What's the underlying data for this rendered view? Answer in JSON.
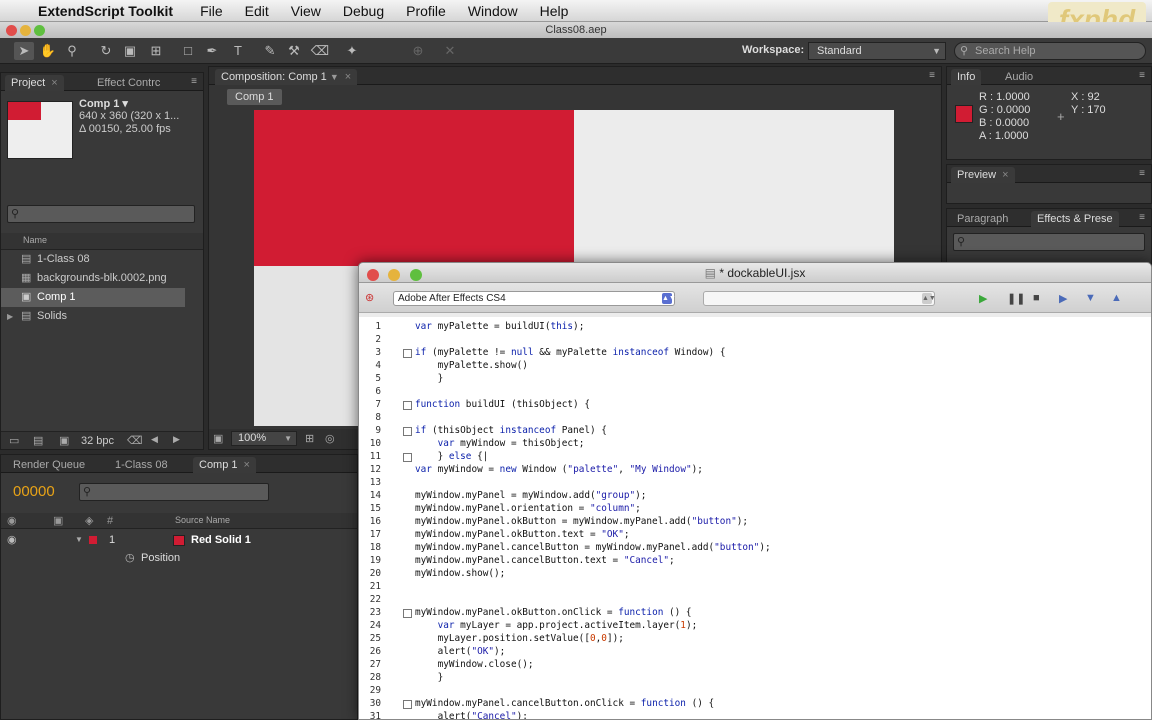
{
  "menubar": {
    "app": "ExtendScript Toolkit",
    "items": [
      "File",
      "Edit",
      "View",
      "Debug",
      "Profile",
      "Window",
      "Help"
    ],
    "logo": "fxphd"
  },
  "ae": {
    "title": "Class08.aep",
    "workspace_label": "Workspace:",
    "workspace_value": "Standard",
    "search_help": "Search Help"
  },
  "project": {
    "tab": "Project",
    "tab2": "Effect Contrc",
    "comp_name": "Comp 1 ▾",
    "comp_size": "640 x 360  (320 x 1...",
    "comp_duration": "Δ 00150, 25.00 fps",
    "col_name": "Name",
    "items": [
      "1-Class 08",
      "backgrounds-blk.0002.png",
      "Comp 1",
      "Solids"
    ],
    "bpc": "32 bpc"
  },
  "composition": {
    "tab": "Composition: Comp 1",
    "breadcrumb": "Comp 1",
    "zoom": "100%"
  },
  "info": {
    "tab": "Info",
    "tab2": "Audio",
    "r": "R : 1.0000",
    "g": "G : 0.0000",
    "b": "B : 0.0000",
    "a": "A : 1.0000",
    "x": "X : 92",
    "y": "Y : 170"
  },
  "preview": {
    "tab": "Preview"
  },
  "effects": {
    "tab1": "Paragraph",
    "tab2": "Effects & Prese"
  },
  "timeline": {
    "tabs": [
      "Render Queue",
      "1-Class 08",
      "Comp 1"
    ],
    "timecode": "00000",
    "col_source": "Source Name",
    "layer_num": "1",
    "layer_name": "Red Solid 1",
    "prop": "Position"
  },
  "editor": {
    "title": "* dockableUI.jsx",
    "target": "Adobe After Effects CS4",
    "lines": [
      {
        "n": "1",
        "t": "var myPalette = buildUI(this);",
        "fold": false
      },
      {
        "n": "2",
        "t": "",
        "fold": false
      },
      {
        "n": "3",
        "t": "if (myPalette != null && myPalette instanceof Window) {",
        "fold": true
      },
      {
        "n": "4",
        "t": "    myPalette.show()",
        "fold": false
      },
      {
        "n": "5",
        "t": "    }",
        "fold": false
      },
      {
        "n": "6",
        "t": "",
        "fold": false
      },
      {
        "n": "7",
        "t": "function buildUI (thisObject) {",
        "fold": true
      },
      {
        "n": "8",
        "t": "",
        "fold": false
      },
      {
        "n": "9",
        "t": "if (thisObject instanceof Panel) {",
        "fold": true
      },
      {
        "n": "10",
        "t": "    var myWindow = thisObject;",
        "fold": false
      },
      {
        "n": "11",
        "t": "    } else {|",
        "fold": true
      },
      {
        "n": "12",
        "t": "var myWindow = new Window (\"palette\", \"My Window\");",
        "fold": false
      },
      {
        "n": "13",
        "t": "",
        "fold": false
      },
      {
        "n": "14",
        "t": "myWindow.myPanel = myWindow.add(\"group\");",
        "fold": false
      },
      {
        "n": "15",
        "t": "myWindow.myPanel.orientation = \"column\";",
        "fold": false
      },
      {
        "n": "16",
        "t": "myWindow.myPanel.okButton = myWindow.myPanel.add(\"button\");",
        "fold": false
      },
      {
        "n": "17",
        "t": "myWindow.myPanel.okButton.text = \"OK\";",
        "fold": false
      },
      {
        "n": "18",
        "t": "myWindow.myPanel.cancelButton = myWindow.myPanel.add(\"button\");",
        "fold": false
      },
      {
        "n": "19",
        "t": "myWindow.myPanel.cancelButton.text = \"Cancel\";",
        "fold": false
      },
      {
        "n": "20",
        "t": "myWindow.show();",
        "fold": false
      },
      {
        "n": "21",
        "t": "",
        "fold": false
      },
      {
        "n": "22",
        "t": "",
        "fold": false
      },
      {
        "n": "23",
        "t": "myWindow.myPanel.okButton.onClick = function () {",
        "fold": true
      },
      {
        "n": "24",
        "t": "    var myLayer = app.project.activeItem.layer(1);",
        "fold": false
      },
      {
        "n": "25",
        "t": "    myLayer.position.setValue([0,0]);",
        "fold": false
      },
      {
        "n": "26",
        "t": "    alert(\"OK\");",
        "fold": false
      },
      {
        "n": "27",
        "t": "    myWindow.close();",
        "fold": false
      },
      {
        "n": "28",
        "t": "    }",
        "fold": false
      },
      {
        "n": "29",
        "t": "",
        "fold": false
      },
      {
        "n": "30",
        "t": "myWindow.myPanel.cancelButton.onClick = function () {",
        "fold": true
      },
      {
        "n": "31",
        "t": "    alert(\"Cancel\");",
        "fold": false
      }
    ]
  },
  "colors": {
    "red": "#d11c33",
    "accent_orange": "#e8a317"
  }
}
